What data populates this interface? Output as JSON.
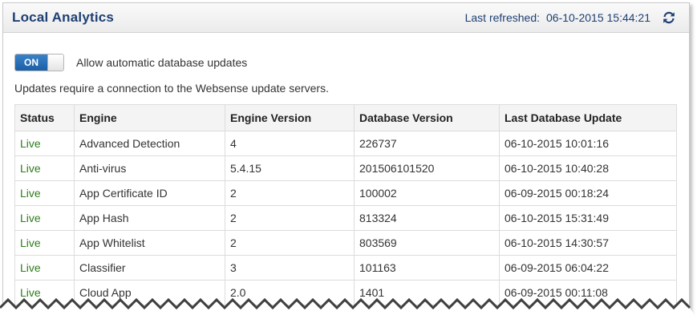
{
  "header": {
    "title": "Local Analytics",
    "last_refreshed_label": "Last refreshed:",
    "last_refreshed_value": "06-10-2015 15:44:21",
    "refresh_icon": "refresh-icon"
  },
  "toggle": {
    "state_label": "ON",
    "label": "Allow automatic database updates"
  },
  "note": "Updates require a connection to the Websense update servers.",
  "table": {
    "columns": [
      "Status",
      "Engine",
      "Engine Version",
      "Database Version",
      "Last Database Update"
    ],
    "rows": [
      [
        "Live",
        "Advanced Detection",
        "4",
        "226737",
        "06-10-2015 10:01:16"
      ],
      [
        "Live",
        "Anti-virus",
        "5.4.15",
        "201506101520",
        "06-10-2015 10:40:28"
      ],
      [
        "Live",
        "App Certificate ID",
        "2",
        "100002",
        "06-09-2015 00:18:24"
      ],
      [
        "Live",
        "App Hash",
        "2",
        "813324",
        "06-10-2015 15:31:49"
      ],
      [
        "Live",
        "App Whitelist",
        "2",
        "803569",
        "06-10-2015 14:30:57"
      ],
      [
        "Live",
        "Classifier",
        "3",
        "101163",
        "06-09-2015 06:04:22"
      ],
      [
        "Live",
        "Cloud App",
        "2.0",
        "1401",
        "06-09-2015 00:11:08"
      ]
    ]
  },
  "colors": {
    "title": "#1e3f73",
    "live_status": "#2e7d1a",
    "toggle_on": "#1b5fa6"
  }
}
